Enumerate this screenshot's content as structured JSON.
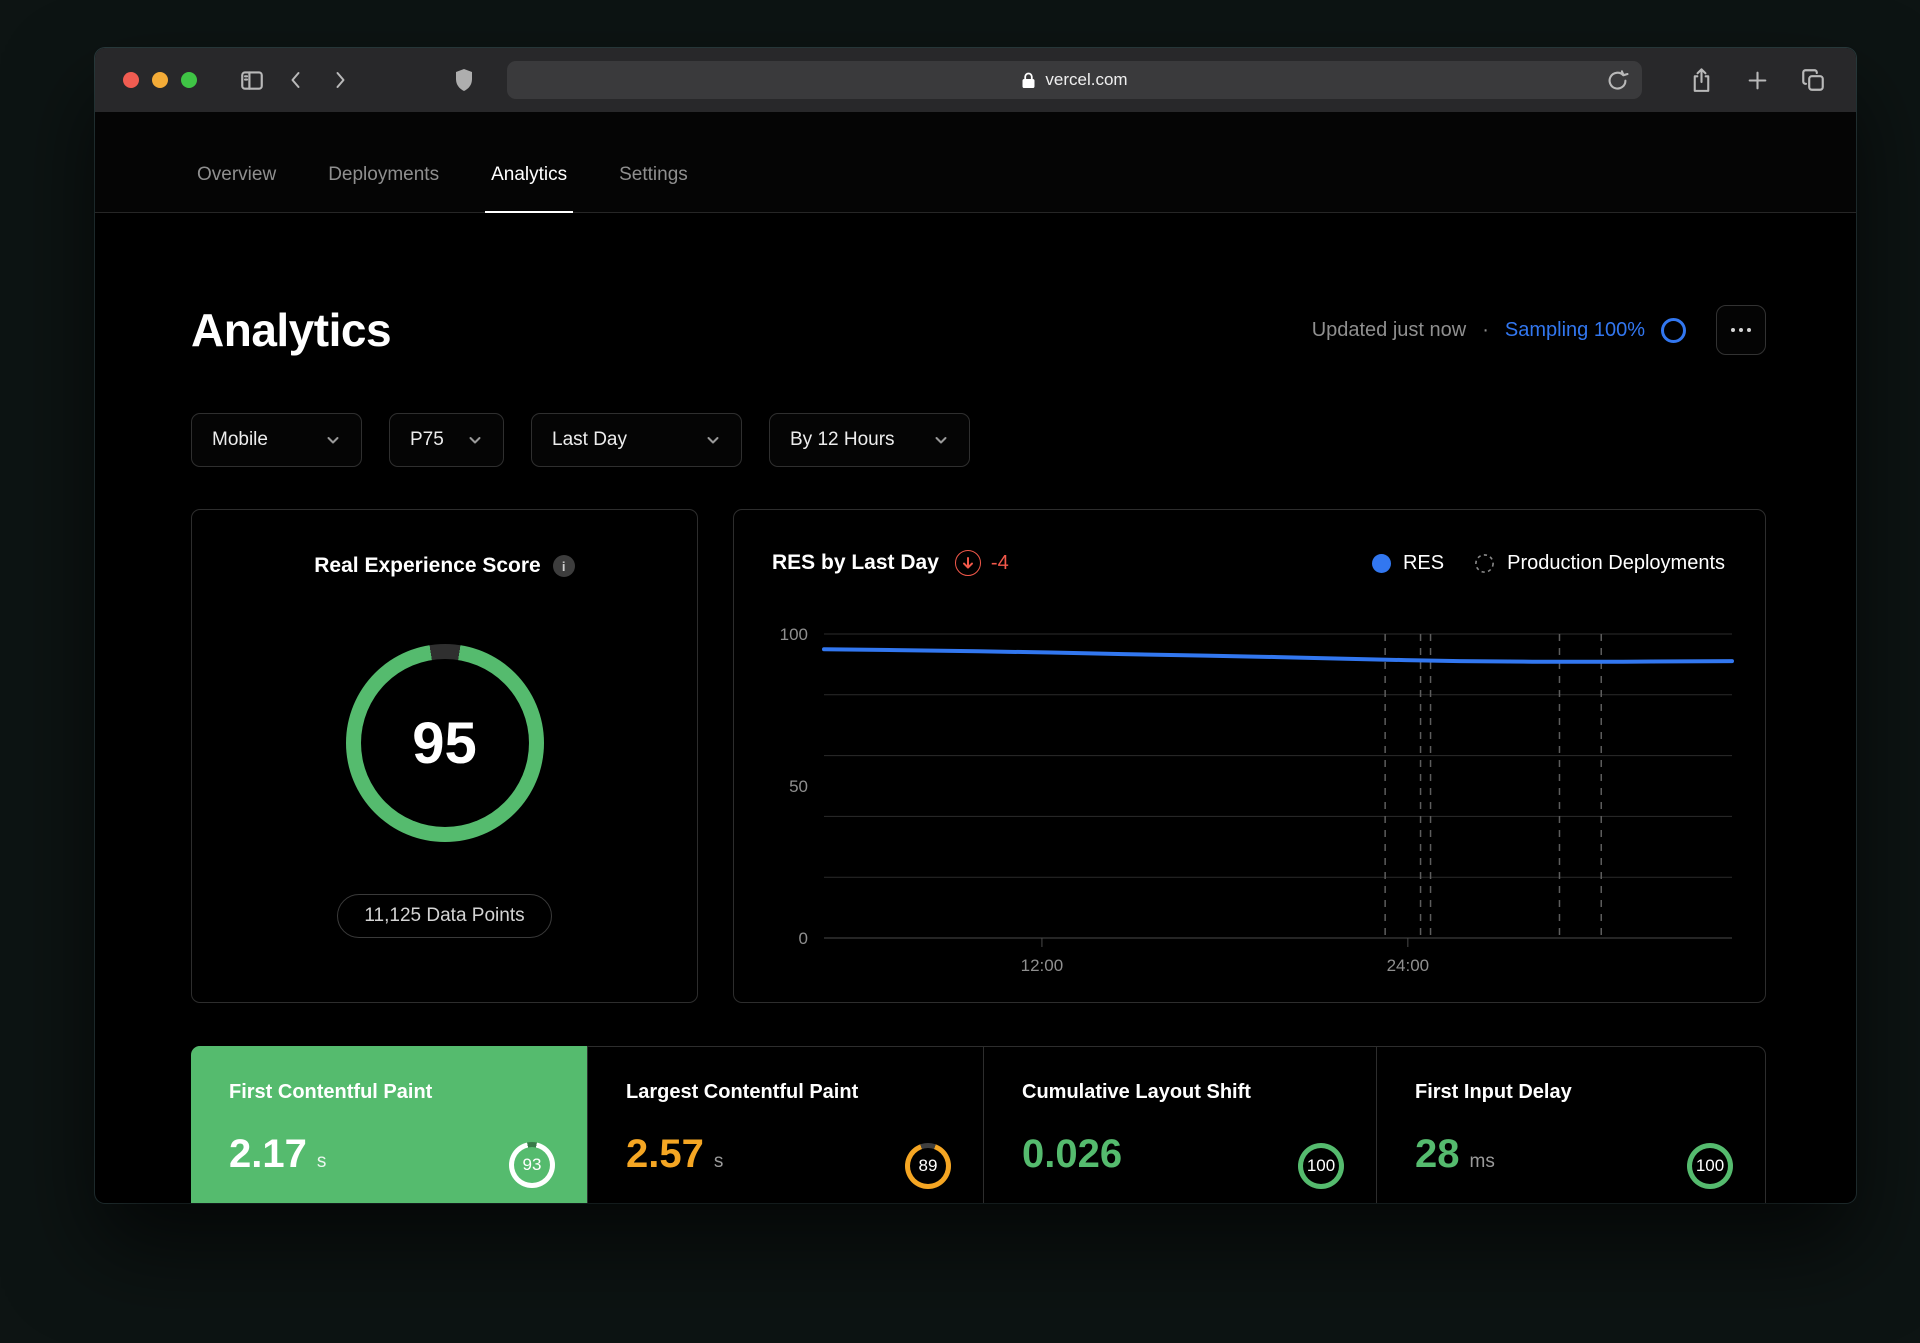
{
  "browser": {
    "url": "vercel.com"
  },
  "nav": {
    "tabs": [
      {
        "label": "Overview"
      },
      {
        "label": "Deployments"
      },
      {
        "label": "Analytics"
      },
      {
        "label": "Settings"
      }
    ],
    "active_index": 2
  },
  "header": {
    "title": "Analytics",
    "updated": "Updated just now",
    "separator": "·",
    "sampling": "Sampling 100%",
    "more_label": "more-options"
  },
  "filters": [
    {
      "label": "Mobile"
    },
    {
      "label": "P75"
    },
    {
      "label": "Last Day"
    },
    {
      "label": "By 12 Hours"
    }
  ],
  "score_card": {
    "title": "Real Experience Score",
    "score": "95",
    "score_pct": 95,
    "data_points_label": "11,125 Data Points"
  },
  "chart_card": {
    "title": "RES by Last Day",
    "delta": "-4",
    "legend": {
      "res": "RES",
      "deployments": "Production Deployments"
    }
  },
  "chart_data": {
    "type": "line",
    "title": "RES by Last Day",
    "ylabel": "Real Experience Score",
    "ylim": [
      0,
      100
    ],
    "yticks": [
      100,
      50,
      0
    ],
    "gridline_values": [
      100,
      80,
      60,
      40,
      20,
      0
    ],
    "grid": true,
    "xticks": [
      {
        "label": "12:00",
        "pos": 0.24
      },
      {
        "label": "24:00",
        "pos": 0.643
      }
    ],
    "series": [
      {
        "name": "RES",
        "color_key": "blue",
        "points": [
          [
            0,
            95
          ],
          [
            0.08,
            94.7
          ],
          [
            0.17,
            94.3
          ],
          [
            0.25,
            93.9
          ],
          [
            0.33,
            93.4
          ],
          [
            0.42,
            92.9
          ],
          [
            0.5,
            92.4
          ],
          [
            0.58,
            91.8
          ],
          [
            0.64,
            91.4
          ],
          [
            0.7,
            91.1
          ],
          [
            0.78,
            90.9
          ],
          [
            0.88,
            90.9
          ],
          [
            1,
            91.1
          ]
        ]
      }
    ],
    "deployment_markers_pos": [
      0.618,
      0.657,
      0.668,
      0.81,
      0.856
    ],
    "legend": [
      "RES",
      "Production Deployments"
    ],
    "legend_position": "top-right"
  },
  "metrics": [
    {
      "title": "First Contentful Paint",
      "value": "2.17",
      "unit": "s",
      "score": "93",
      "score_pct": 93
    },
    {
      "title": "Largest Contentful Paint",
      "value": "2.57",
      "unit": "s",
      "score": "89",
      "score_pct": 89
    },
    {
      "title": "Cumulative Layout Shift",
      "value": "0.026",
      "unit": "",
      "score": "100",
      "score_pct": 100
    },
    {
      "title": "First Input Delay",
      "value": "28",
      "unit": "ms",
      "score": "100",
      "score_pct": 100
    }
  ],
  "colors": {
    "blue": "#3277f0",
    "green": "#55bb6e",
    "orange": "#f5a623",
    "red": "#f2584a"
  }
}
